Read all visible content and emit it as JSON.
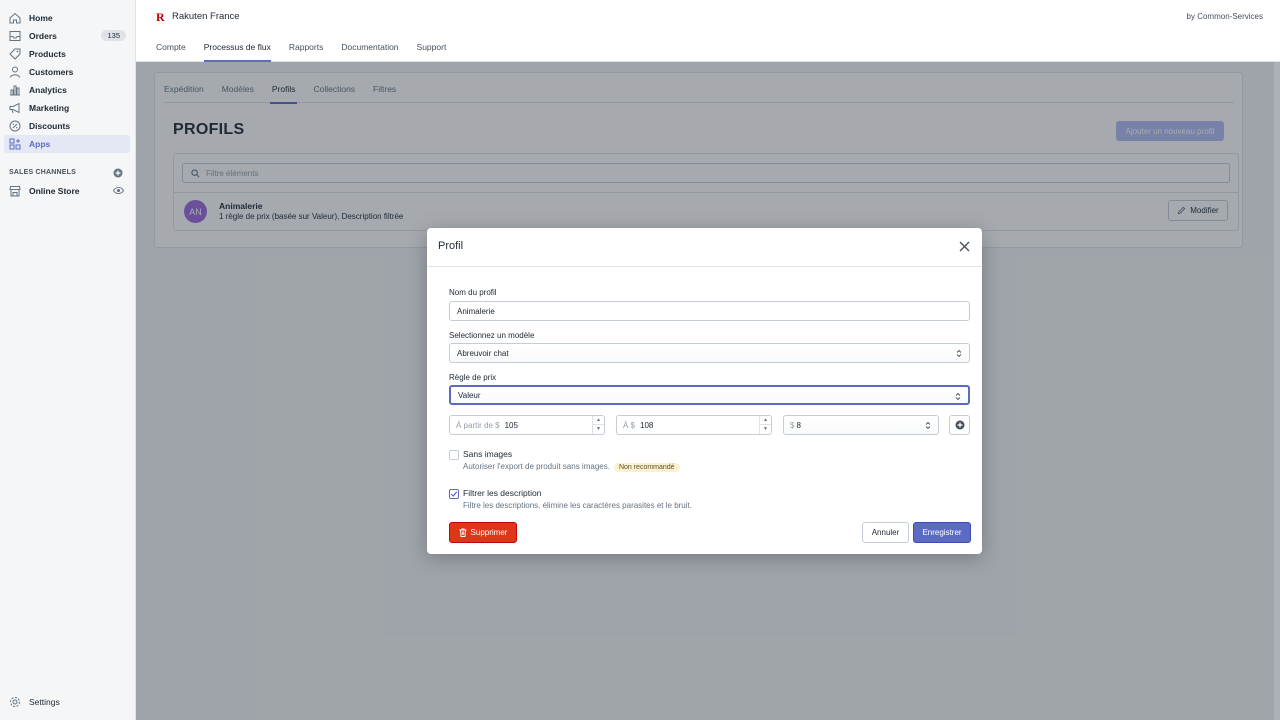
{
  "sidebar": {
    "items": [
      {
        "label": "Home",
        "icon": "home-icon"
      },
      {
        "label": "Orders",
        "icon": "orders-icon",
        "badge": "135"
      },
      {
        "label": "Products",
        "icon": "tag-icon"
      },
      {
        "label": "Customers",
        "icon": "person-icon"
      },
      {
        "label": "Analytics",
        "icon": "bar-chart-icon"
      },
      {
        "label": "Marketing",
        "icon": "megaphone-icon"
      },
      {
        "label": "Discounts",
        "icon": "discount-icon"
      },
      {
        "label": "Apps",
        "icon": "apps-icon",
        "active": true
      }
    ],
    "sales_channels_title": "SALES CHANNELS",
    "online_store": "Online Store",
    "settings": "Settings"
  },
  "appbar": {
    "logo": "R",
    "app_name": "Rakuten France",
    "by": "by Common-Services",
    "tabs": [
      "Compte",
      "Processus de flux",
      "Rapports",
      "Documentation",
      "Support"
    ],
    "active_tab": "Processus de flux"
  },
  "main": {
    "sub_tabs": [
      "Expédition",
      "Modèles",
      "Profils",
      "Collections",
      "Filtres"
    ],
    "active_sub_tab": "Profils",
    "title": "PROFILS",
    "new_profile_button": "Ajouter un nouveau profil",
    "filter_placeholder": "Filtre éléments",
    "item": {
      "avatar": "AN",
      "title": "Animalerie",
      "subtitle": "1 règle de prix (basée sur Valeur), Description filtrée",
      "edit_button": "Modifier"
    }
  },
  "modal": {
    "title": "Profil",
    "profile_name_label": "Nom du profil",
    "profile_name_value": "Animalerie",
    "model_label": "Selectionnez un modèle",
    "model_value": "Abreuvoir chat",
    "price_rule_label": "Règle de prix",
    "price_rule_value": "Valeur",
    "range": {
      "from_prefix": "À partir de $",
      "from_value": "105",
      "to_prefix": "À $",
      "to_value": "108",
      "price_prefix": "$",
      "price_value": "8"
    },
    "no_images_label": "Sans images",
    "no_images_help": "Autoriser l'export de produit sans images.",
    "not_recommended": "Non recommandé",
    "no_images_checked": false,
    "filter_desc_label": "Filtrer les description",
    "filter_desc_help": "Filtre les descriptions, élimine les caractères parasites et le bruit.",
    "filter_desc_checked": true,
    "delete_button": "Supprimer",
    "cancel_button": "Annuler",
    "save_button": "Enregistrer"
  },
  "colors": {
    "accent": "#5c6ac4",
    "danger": "#de3618",
    "avatar": "#9c6ade",
    "brand": "#bf0000"
  }
}
